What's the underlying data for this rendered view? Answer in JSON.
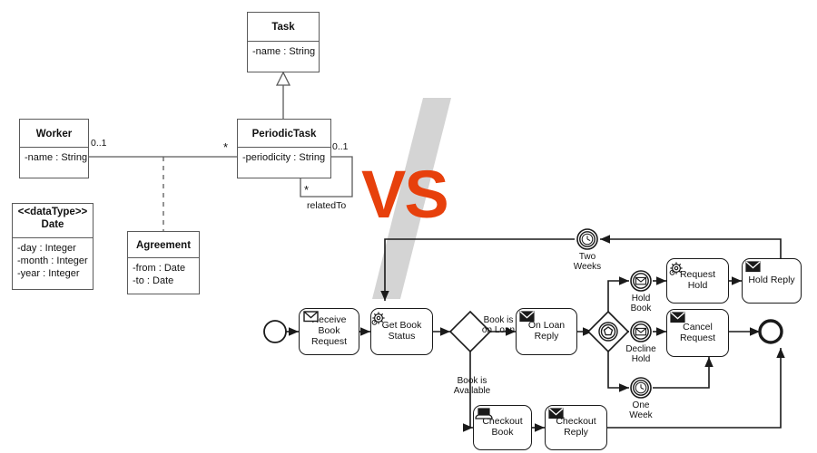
{
  "divider": {
    "vs_label": "VS",
    "vs_color": "#E7400C",
    "band_color": "#D4D4D4"
  },
  "uml": {
    "classes": [
      {
        "id": "task",
        "name": "Task",
        "stereotype": "",
        "attributes": [
          "-name : String"
        ]
      },
      {
        "id": "periodictask",
        "name": "PeriodicTask",
        "stereotype": "",
        "attributes": [
          "-periodicity : String"
        ]
      },
      {
        "id": "worker",
        "name": "Worker",
        "stereotype": "",
        "attributes": [
          "-name : String"
        ]
      },
      {
        "id": "date",
        "name": "Date",
        "stereotype": "<<dataType>>",
        "attributes": [
          "-day : Integer",
          "-month : Integer",
          "-year : Integer"
        ]
      },
      {
        "id": "agreement",
        "name": "Agreement",
        "stereotype": "",
        "attributes": [
          "-from : Date",
          "-to : Date"
        ]
      }
    ],
    "labels": {
      "worker_mult": "0..1",
      "periodictask_mult": "*",
      "related_mult_top": "0..1",
      "related_mult_bottom": "*",
      "related_role": "relatedTo"
    }
  },
  "bpmn": {
    "tasks": [
      {
        "id": "receive-book-request",
        "label": "Receive\nBook\nRequest",
        "icon": "message-receive-icon"
      },
      {
        "id": "get-book-status",
        "label": "Get Book\nStatus",
        "icon": "service-gear-icon"
      },
      {
        "id": "on-loan-reply",
        "label": "On Loan\nReply",
        "icon": "message-send-icon"
      },
      {
        "id": "request-hold",
        "label": "Request\nHold",
        "icon": "service-gear-icon"
      },
      {
        "id": "hold-reply",
        "label": "Hold Reply",
        "icon": "message-send-icon"
      },
      {
        "id": "cancel-request",
        "label": "Cancel\nRequest",
        "icon": "message-send-icon"
      },
      {
        "id": "checkout-book",
        "label": "Checkout\nBook",
        "icon": "manual-task-icon"
      },
      {
        "id": "checkout-reply",
        "label": "Checkout\nReply",
        "icon": "message-send-icon"
      }
    ],
    "events": [
      {
        "id": "start-event",
        "label": "",
        "type": "start"
      },
      {
        "id": "two-weeks-timer",
        "label": "Two\nWeeks",
        "type": "timer-intermediate"
      },
      {
        "id": "hold-book-message",
        "label": "Hold\nBook",
        "type": "message-intermediate"
      },
      {
        "id": "decline-hold-message",
        "label": "Decline\nHold",
        "type": "message-intermediate"
      },
      {
        "id": "one-week-timer",
        "label": "One\nWeek",
        "type": "timer-intermediate"
      },
      {
        "id": "end-event",
        "label": "",
        "type": "end"
      }
    ],
    "gateways": [
      {
        "id": "exclusive-gateway",
        "type": "exclusive"
      },
      {
        "id": "event-based-gateway",
        "type": "event-based"
      }
    ],
    "flow_labels": [
      {
        "id": "book-is-on-loan",
        "label": "Book is\non Loan"
      },
      {
        "id": "book-is-available",
        "label": "Book is\nAvailable"
      }
    ]
  }
}
